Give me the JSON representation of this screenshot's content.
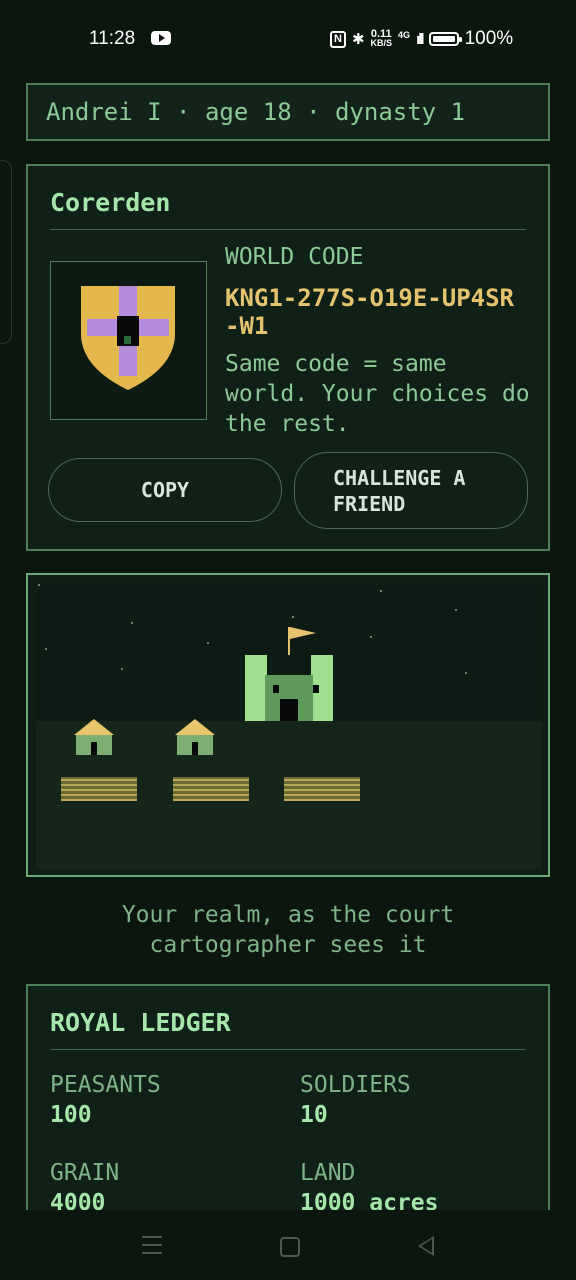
{
  "status_bar": {
    "time": "11:28",
    "network_speed_value": "0.11",
    "network_speed_unit": "KB/S",
    "network_type": "4G",
    "battery": "100%"
  },
  "header": {
    "text": "Andrei I · age 18 · dynasty 1"
  },
  "realm": {
    "name": "Corerden",
    "world_code_label": "WORLD CODE",
    "world_code": "KNG1-277S-O19E-UP4SR-W1",
    "note": "Same code = same world. Your choices do the rest.",
    "copy_label": "COPY",
    "challenge_line1": "CHALLENGE A",
    "challenge_line2": "FRIEND",
    "crest_colors": {
      "shield": "#e5b84d",
      "cross": "#b48adb",
      "center": "#0a0a0a"
    }
  },
  "map": {
    "caption_line1": "Your realm, as the court",
    "caption_line2": "cartographer sees it",
    "colors": {
      "sky": "#0e1a14",
      "ground": "#132619",
      "castle": "#9ee08f",
      "house": "#7fae73",
      "roof": "#e8c56a",
      "field": "#b8a95a",
      "flag": "#e5c36e"
    }
  },
  "ledger": {
    "title": "ROYAL LEDGER",
    "stats": [
      {
        "label": "PEASANTS",
        "value": "100"
      },
      {
        "label": "SOLDIERS",
        "value": "10"
      },
      {
        "label": "GRAIN",
        "value": "4000"
      },
      {
        "label": "LAND",
        "value": "1000 acres"
      }
    ]
  },
  "nav_bar": {
    "icons": [
      "menu-icon",
      "home-icon",
      "back-icon"
    ]
  }
}
